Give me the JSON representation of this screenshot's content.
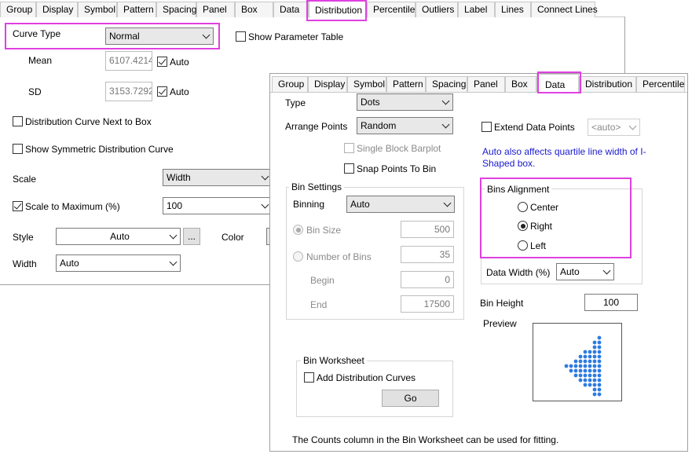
{
  "back": {
    "tabs": [
      "Group",
      "Display",
      "Symbol",
      "Pattern",
      "Spacing",
      "Panel",
      "Box",
      "Data",
      "Distribution",
      "Percentile",
      "Outliers",
      "Label",
      "Lines",
      "Connect Lines"
    ],
    "active_tab": "Distribution",
    "curve_type_label": "Curve Type",
    "curve_type_value": "Normal",
    "show_param_table": "Show Parameter Table",
    "mean_label": "Mean",
    "mean_value": "6107.4214",
    "mean_auto": "Auto",
    "sd_label": "SD",
    "sd_value": "3153.7292",
    "sd_auto": "Auto",
    "dist_next_box": "Distribution Curve Next to Box",
    "show_symmetric": "Show Symmetric Distribution Curve",
    "scale_label": "Scale",
    "scale_value": "Width",
    "scale_max_label": "Scale to Maximum (%)",
    "scale_max_value": "100",
    "style_label": "Style",
    "style_value": "Auto",
    "style_btn": "...",
    "color_label": "Color",
    "width_label": "Width",
    "width_value": "Auto"
  },
  "front": {
    "tabs": [
      "Group",
      "Display",
      "Symbol",
      "Pattern",
      "Spacing",
      "Panel",
      "Box",
      "Data",
      "Distribution",
      "Percentile"
    ],
    "active_tab": "Data",
    "type_label": "Type",
    "type_value": "Dots",
    "arrange_label": "Arrange Points",
    "arrange_value": "Random",
    "single_block": "Single Block Barplot",
    "snap_points": "Snap Points To Bin",
    "extend_data": "Extend Data Points",
    "extend_value": "<auto>",
    "auto_note": "Auto also affects quartile line width of I-Shaped box.",
    "bin_settings": "Bin Settings",
    "binning_label": "Binning",
    "binning_value": "Auto",
    "bin_size_label": "Bin Size",
    "bin_size_value": "500",
    "num_bins_label": "Number of Bins",
    "num_bins_value": "35",
    "begin_label": "Begin",
    "begin_value": "0",
    "end_label": "End",
    "end_value": "17500",
    "bins_alignment": "Bins Alignment",
    "align_center": "Center",
    "align_right": "Right",
    "align_left": "Left",
    "data_width_label": "Data Width (%)",
    "data_width_value": "Auto",
    "bin_height_label": "Bin Height",
    "bin_height_value": "100",
    "preview_label": "Preview",
    "bin_worksheet": "Bin Worksheet",
    "add_dist_curves": "Add Distribution Curves",
    "go_btn": "Go",
    "footer_note": "The Counts column in the Bin Worksheet can be used for fitting.",
    "accent_color": "#e040e0",
    "note_color": "#1a1ad0",
    "dot_color": "#2d7be0"
  }
}
